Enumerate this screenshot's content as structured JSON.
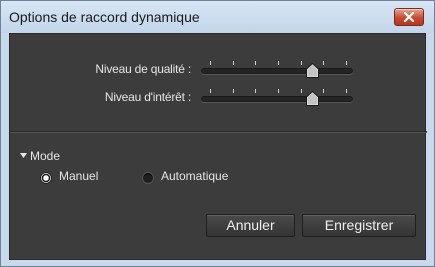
{
  "window": {
    "title": "Options de raccord dynamique"
  },
  "sliders": [
    {
      "label": "Niveau de qualité :",
      "value_fraction": 0.75,
      "tick_count": 7
    },
    {
      "label": "Niveau d'intérêt :",
      "value_fraction": 0.75,
      "tick_count": 7
    }
  ],
  "mode": {
    "header": "Mode",
    "options": [
      {
        "label": "Manuel",
        "selected": true
      },
      {
        "label": "Automatique",
        "selected": false
      }
    ]
  },
  "buttons": {
    "cancel": "Annuler",
    "save": "Enregistrer"
  },
  "colors": {
    "panel_bg": "#3c3c3c",
    "frame": "#c9d9ec",
    "close_red": "#c74a33"
  },
  "icons": {
    "close": "close-icon",
    "disclosure": "triangle-down-icon",
    "slider_thumb": "slider-thumb-icon"
  }
}
